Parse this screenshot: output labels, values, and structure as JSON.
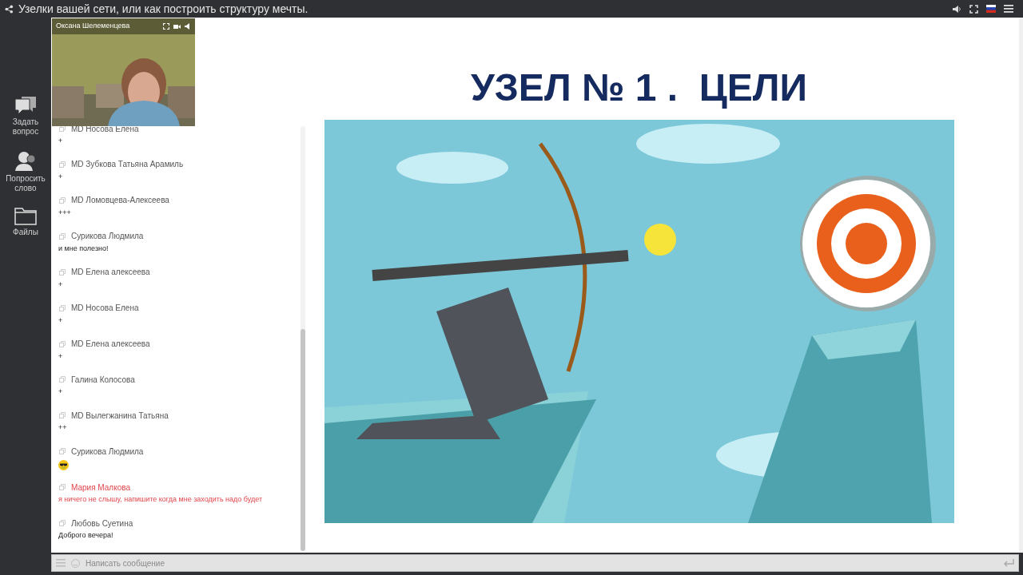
{
  "top_bar": {
    "title": "Узелки вашей сети, или как построить структуру мечты."
  },
  "sidebar": {
    "items": [
      {
        "kind": "ask",
        "label": "Задать\nвопрос"
      },
      {
        "kind": "speak",
        "label": "Попросить\nслово"
      },
      {
        "kind": "files",
        "label": "Файлы"
      }
    ]
  },
  "video": {
    "name": "Оксана Шелеменцева"
  },
  "chat": {
    "messages": [
      {
        "author": "MD Носова Елена",
        "kind": "text",
        "text": "+",
        "highlighted": false
      },
      {
        "author": "MD Зубкова Татьяна Арамиль",
        "kind": "text",
        "text": "+",
        "highlighted": false
      },
      {
        "author": "MD Ломовцева-Алексеева",
        "kind": "text",
        "text": "+++",
        "highlighted": false
      },
      {
        "author": "Сурикова Людмила",
        "kind": "text",
        "text": "и мне полезно!",
        "highlighted": false
      },
      {
        "author": "MD Елена алексеева",
        "kind": "text",
        "text": "+",
        "highlighted": false
      },
      {
        "author": "MD Носова Елена",
        "kind": "text",
        "text": "+",
        "highlighted": false
      },
      {
        "author": "MD Елена алексеева",
        "kind": "text",
        "text": "+",
        "highlighted": false
      },
      {
        "author": "Галина Колосова",
        "kind": "text",
        "text": "+",
        "highlighted": false
      },
      {
        "author": "MD Вылегжанина Татьяна",
        "kind": "text",
        "text": "++",
        "highlighted": false
      },
      {
        "author": "Сурикова Людмила",
        "kind": "emoji",
        "highlighted": false
      },
      {
        "author": "Мария Малкова",
        "kind": "text",
        "text": "я ничего не слышу, напишите когда мне заходить надо будет",
        "highlighted": true
      },
      {
        "author": "Любовь Суетина",
        "kind": "text",
        "text": "Доброго вечера!",
        "highlighted": false
      }
    ],
    "input": {
      "placeholder": "Написать сообщение"
    }
  },
  "slide": {
    "title": "УЗЕЛ № 1 .  ЦЕЛИ"
  }
}
